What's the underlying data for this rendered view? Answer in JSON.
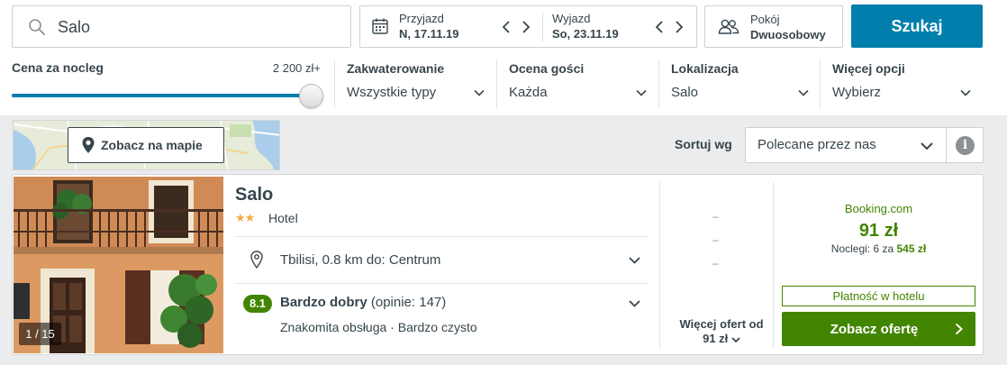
{
  "search": {
    "value": "Salo",
    "icon": "magnifier-icon"
  },
  "dates": {
    "checkin_label": "Przyjazd",
    "checkin_value": "N, 17.11.19",
    "checkout_label": "Wyjazd",
    "checkout_value": "So, 23.11.19"
  },
  "room": {
    "label": "Pokój",
    "value": "Dwuosobowy"
  },
  "search_button": "Szukaj",
  "filters": {
    "price_title": "Cena za nocleg",
    "price_max": "2 200 zł+",
    "price_level": 1.0,
    "accommodation": {
      "title": "Zakwaterowanie",
      "value": "Wszystkie typy"
    },
    "rating": {
      "title": "Ocena gości",
      "value": "Każda"
    },
    "location": {
      "title": "Lokalizacja",
      "value": "Salo"
    },
    "more": {
      "title": "Więcej opcji",
      "value": "Wybierz"
    }
  },
  "map_button": "Zobacz na mapie",
  "sort": {
    "label": "Sortuj wg",
    "value": "Polecane przez nas"
  },
  "item": {
    "name": "Salo",
    "stars": 2,
    "stars_text": "★★",
    "type": "Hotel",
    "photo_count": "1 / 15",
    "location": "Tbilisi, 0.8 km do: Centrum",
    "rating_score": "8.1",
    "rating_text": "Bardzo dobry",
    "rating_count": "(opinie: 147)",
    "highlights": "Znakomita obsługa · Bardzo czysto",
    "placeholder_dash": "–",
    "more_offers_line1": "Więcej ofert od",
    "more_offers_line2": "91 zł",
    "provider": "Booking.com",
    "price": "91 zł",
    "nights_text": "Noclegi: 6 za",
    "nights_total": "545 zł",
    "payment": "Płatność w hotelu",
    "deal_button": "Zobacz ofertę"
  },
  "colors": {
    "accent": "#007fad",
    "deal": "#428500",
    "text": "#37454d",
    "star": "#f6ab3f",
    "background_grey": "#ebecee"
  }
}
